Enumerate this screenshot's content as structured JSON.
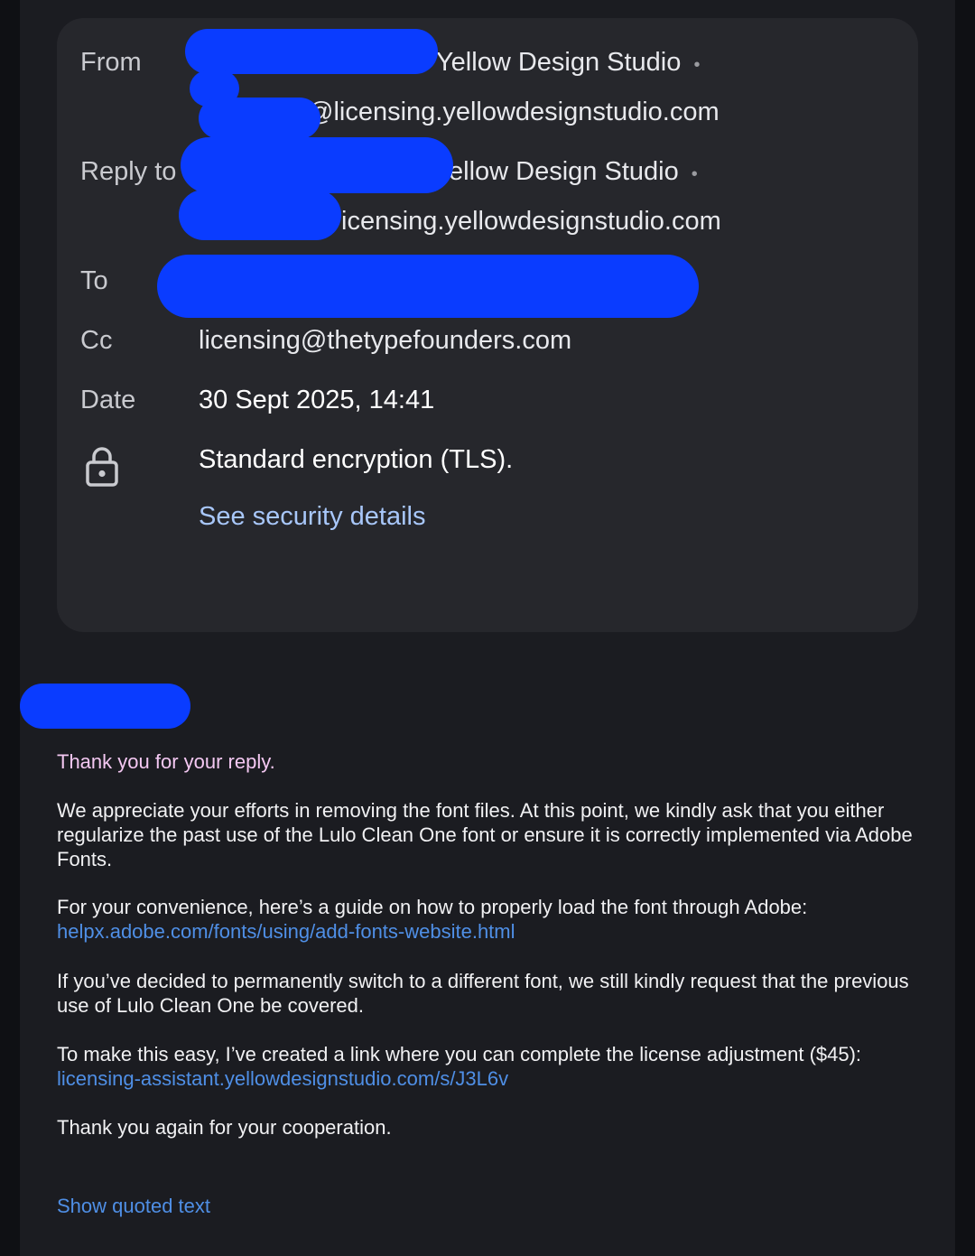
{
  "header": {
    "from_label": "From",
    "from_name": "Yellow Design Studio",
    "from_email": "@licensing.yellowdesignstudio.com",
    "reply_label": "Reply to",
    "reply_name": "ellow Design Studio",
    "reply_email": "icensing.yellowdesignstudio.com",
    "to_label": "To",
    "cc_label": "Cc",
    "cc_value": "licensing@thetypefounders.com",
    "date_label": "Date",
    "date_value": "30 Sept 2025, 14:41",
    "encryption": "Standard encryption (TLS).",
    "security_link": "See security details",
    "dot": "•"
  },
  "body": {
    "greeting": "Thank you for your reply.",
    "p1": "We appreciate your efforts in removing the font files. At this point, we kindly ask that you either regularize the past use of the Lulo Clean One font or ensure it is correctly implemented via Adobe Fonts.",
    "p2": "For your convenience, here’s a guide on how to properly load the font through Adobe:",
    "link1": "helpx.adobe.com/fonts/using/add-fonts-website.html",
    "p3": "If you’ve decided to permanently switch to a different font, we still kindly request that the previous use of Lulo Clean One be covered.",
    "p4": "To make this easy, I’ve created a link where you can complete the license adjustment ($45):",
    "link2": "licensing-assistant.yellowdesignstudio.com/s/J3L6v",
    "closing": "Thank you again for your cooperation.",
    "show_quoted": "Show quoted text"
  },
  "icons": {
    "lock": "lock-icon"
  },
  "colors": {
    "redaction": "#0a3cff",
    "link": "#a8c7fa",
    "body_link": "#4f8fe6",
    "greeting": "#f4c8f2"
  }
}
